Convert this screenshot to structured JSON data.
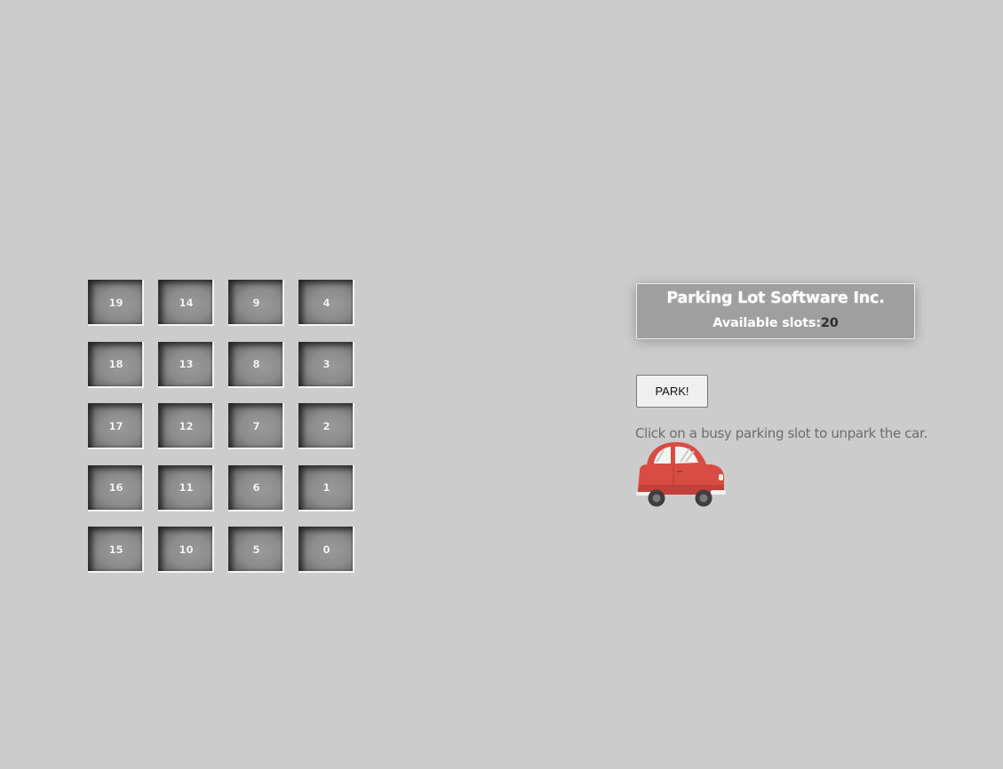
{
  "parking_lot": {
    "slots": [
      {
        "number": "19"
      },
      {
        "number": "14"
      },
      {
        "number": "9"
      },
      {
        "number": "4"
      },
      {
        "number": "18"
      },
      {
        "number": "13"
      },
      {
        "number": "8"
      },
      {
        "number": "3"
      },
      {
        "number": "17"
      },
      {
        "number": "12"
      },
      {
        "number": "7"
      },
      {
        "number": "2"
      },
      {
        "number": "16"
      },
      {
        "number": "11"
      },
      {
        "number": "6"
      },
      {
        "number": "1"
      },
      {
        "number": "15"
      },
      {
        "number": "10"
      },
      {
        "number": "5"
      },
      {
        "number": "0"
      }
    ]
  },
  "panel": {
    "title": "Parking Lot Software Inc.",
    "available_label": "Available slots:",
    "available_count": "20"
  },
  "park_button": {
    "label": "PARK!"
  },
  "hint": "Click on a busy parking slot to unpark the car.",
  "car": {
    "icon": "car-icon",
    "color": "#d84c43"
  },
  "colors": {
    "background": "#cccccc",
    "panel": "#9f9f9f",
    "slot": "#8c8c8c"
  }
}
